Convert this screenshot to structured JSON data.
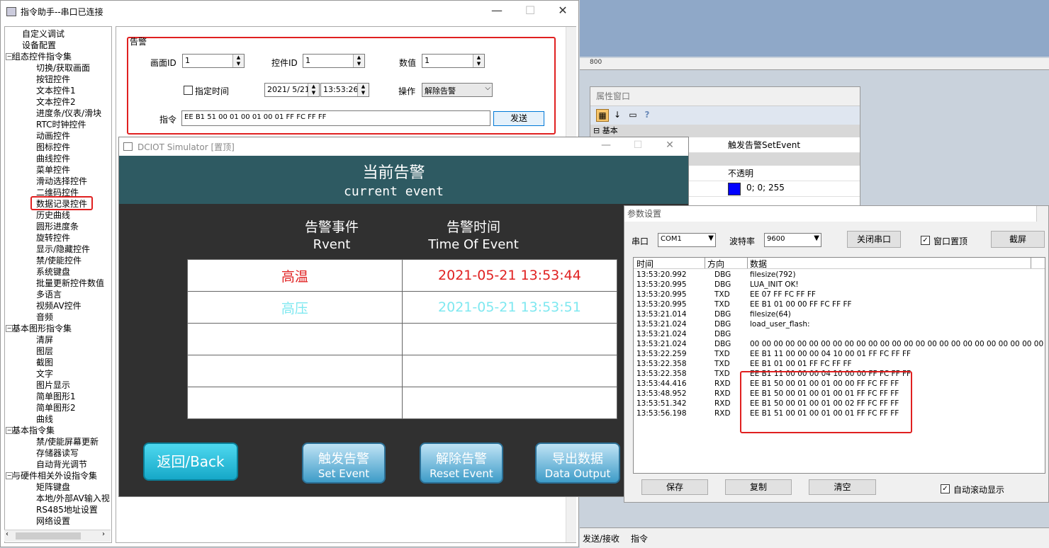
{
  "main_window": {
    "title": "指令助手--串口已连接",
    "minimize": "—",
    "maximize": "☐",
    "close": "✕"
  },
  "tree": [
    {
      "label": "自定义调试",
      "level": 1
    },
    {
      "label": "设备配置",
      "level": 1
    },
    {
      "label": "组态控件指令集",
      "level": 0
    },
    {
      "label": "切换/获取画面",
      "level": 2
    },
    {
      "label": "按钮控件",
      "level": 2
    },
    {
      "label": "文本控件1",
      "level": 2
    },
    {
      "label": "文本控件2",
      "level": 2
    },
    {
      "label": "进度条/仪表/滑块",
      "level": 2
    },
    {
      "label": "RTC时钟控件",
      "level": 2
    },
    {
      "label": "动画控件",
      "level": 2
    },
    {
      "label": "图标控件",
      "level": 2
    },
    {
      "label": "曲线控件",
      "level": 2
    },
    {
      "label": "菜单控件",
      "level": 2
    },
    {
      "label": "滑动选择控件",
      "level": 2
    },
    {
      "label": "二维码控件",
      "level": 2
    },
    {
      "label": "数据记录控件",
      "level": 2,
      "highlight": true
    },
    {
      "label": "历史曲线",
      "level": 2
    },
    {
      "label": "圆形进度条",
      "level": 2
    },
    {
      "label": "旋转控件",
      "level": 2
    },
    {
      "label": "显示/隐藏控件",
      "level": 2
    },
    {
      "label": "禁/使能控件",
      "level": 2
    },
    {
      "label": "系统键盘",
      "level": 2
    },
    {
      "label": "批量更新控件数值",
      "level": 2
    },
    {
      "label": "多语言",
      "level": 2
    },
    {
      "label": "视频AV控件",
      "level": 2
    },
    {
      "label": "音频",
      "level": 2
    },
    {
      "label": "基本图形指令集",
      "level": 0
    },
    {
      "label": "清屏",
      "level": 2
    },
    {
      "label": "图层",
      "level": 2
    },
    {
      "label": "截图",
      "level": 2
    },
    {
      "label": "文字",
      "level": 2
    },
    {
      "label": "图片显示",
      "level": 2
    },
    {
      "label": "简单图形1",
      "level": 2
    },
    {
      "label": "简单图形2",
      "level": 2
    },
    {
      "label": "曲线",
      "level": 2
    },
    {
      "label": "基本指令集",
      "level": 0
    },
    {
      "label": "禁/使能屏幕更新",
      "level": 2
    },
    {
      "label": "存储器读写",
      "level": 2
    },
    {
      "label": "自动背光调节",
      "level": 2
    },
    {
      "label": "与硬件相关外设指令集",
      "level": 0
    },
    {
      "label": "矩阵键盘",
      "level": 2
    },
    {
      "label": "本地/外部AV输入视",
      "level": 2
    },
    {
      "label": "RS485地址设置",
      "level": 2
    },
    {
      "label": "网络设置",
      "level": 2
    }
  ],
  "alarm_panel": {
    "group_title": "告警",
    "screen_id_label": "画面ID",
    "screen_id_value": "1",
    "control_id_label": "控件ID",
    "control_id_value": "1",
    "value_label": "数值",
    "value_value": "1",
    "specify_time_label": "指定时间",
    "date_value": "2021/ 5/21",
    "time_value": "13:53:26",
    "operation_label": "操作",
    "operation_value": "解除告警",
    "command_label": "指令",
    "command_value": "EE B1 51 00 01 00 01 00 01 FF FC FF FF",
    "send_label": "发送"
  },
  "simulator": {
    "title": "DCIOT Simulator [置顶]",
    "header_cn": "当前告警",
    "header_en": "current event",
    "col1_cn": "告警事件",
    "col1_en": "Rvent",
    "col2_cn": "告警时间",
    "col2_en": "Time Of Event",
    "rows": [
      {
        "event": "高温",
        "time": "2021-05-21 13:53:44",
        "color": "#e02020"
      },
      {
        "event": "高压",
        "time": "2021-05-21 13:53:51",
        "color": "#7fe8f0"
      },
      {
        "event": "",
        "time": "",
        "color": "#000000"
      },
      {
        "event": "",
        "time": "",
        "color": "#000000"
      },
      {
        "event": "",
        "time": "",
        "color": "#000000"
      }
    ],
    "back_label": "返回/Back",
    "set_cn": "触发告警",
    "set_en": "Set Event",
    "reset_cn": "解除告警",
    "reset_en": "Reset Event",
    "export_cn": "导出数据",
    "export_en": "Data Output"
  },
  "ide": {
    "ruler_value": "800",
    "status_send_recv": "发送/接收",
    "status_command": "指令"
  },
  "property_window": {
    "title": "属性窗口",
    "section_basic": "基本",
    "event_value": "触发告警SetEvent",
    "opacity_value": "不透明",
    "color_value": "0; 0; 255"
  },
  "param_window": {
    "title": "参数设置",
    "port_label": "串口",
    "port_value": "COM1",
    "baud_label": "波特率",
    "baud_value": "9600",
    "close_port_label": "关闭串口",
    "topmost_label": "窗口置顶",
    "screenshot_label": "截屏",
    "col_time": "时间",
    "col_dir": "方向",
    "col_data": "数据",
    "log": [
      {
        "time": "13:53:20.992",
        "dir": "DBG",
        "data": "filesize(792)"
      },
      {
        "time": "13:53:20.995",
        "dir": "DBG",
        "data": "LUA_INIT OK!"
      },
      {
        "time": "13:53:20.995",
        "dir": "TXD",
        "data": "EE 07 FF FC FF FF"
      },
      {
        "time": "13:53:20.995",
        "dir": "TXD",
        "data": "EE B1 01 00 00 FF FC FF FF"
      },
      {
        "time": "13:53:21.014",
        "dir": "DBG",
        "data": "filesize(64)"
      },
      {
        "time": "13:53:21.024",
        "dir": "DBG",
        "data": "load_user_flash:"
      },
      {
        "time": "13:53:21.024",
        "dir": "DBG",
        "data": ""
      },
      {
        "time": "13:53:21.024",
        "dir": "DBG",
        "data": "00 00 00 00 00 00 00 00 00 00 00 00 00 00 00 00 00 00 00 00 00 00 00 00 00 00 00 …"
      },
      {
        "time": "13:53:22.259",
        "dir": "TXD",
        "data": "EE B1 11 00 00 00 04 10 00 01 FF FC FF FF"
      },
      {
        "time": "13:53:22.358",
        "dir": "TXD",
        "data": "EE B1 01 00 01 FF FC FF FF"
      },
      {
        "time": "13:53:22.358",
        "dir": "TXD",
        "data": "EE B1 11 00 00 00 04 10 00 00 FF FC FF FF"
      },
      {
        "time": "13:53:44.416",
        "dir": "RXD",
        "data": "EE B1 50 00 01 00 01 00 00 FF FC FF FF"
      },
      {
        "time": "13:53:48.952",
        "dir": "RXD",
        "data": "EE B1 50 00 01 00 01 00 01 FF FC FF FF"
      },
      {
        "time": "13:53:51.342",
        "dir": "RXD",
        "data": "EE B1 50 00 01 00 01 00 02 FF FC FF FF"
      },
      {
        "time": "13:53:56.198",
        "dir": "RXD",
        "data": "EE B1 51 00 01 00 01 00 01 FF FC FF FF"
      }
    ],
    "save_label": "保存",
    "copy_label": "复制",
    "clear_label": "清空",
    "autoscroll_label": "自动滚动显示"
  }
}
